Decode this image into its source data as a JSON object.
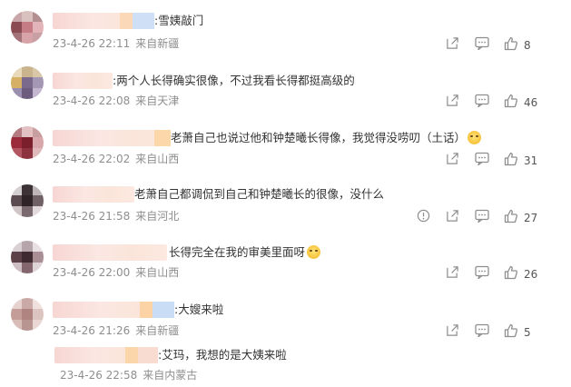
{
  "comments": [
    {
      "text": ":雪姨敲门",
      "time": "23-4-26 22:11",
      "location": "来自新疆",
      "likes": "8",
      "emoji": false
    },
    {
      "text": ":两个人长得确实很像，不过我看长得都挺高级的",
      "time": "23-4-26 22:08",
      "location": "来自天津",
      "likes": "46",
      "emoji": false
    },
    {
      "text": "老萧自己也说过他和钟楚曦长得像，我觉得没唠叨（土话）",
      "time": "23-4-26 22:02",
      "location": "来自山西",
      "likes": "31",
      "emoji": true
    },
    {
      "text": "老萧自己都调侃到自己和钟楚曦长的很像，没什么",
      "time": "23-4-26 21:58",
      "location": "来自河北",
      "likes": "27",
      "emoji": false
    },
    {
      "text": "长得完全在我的审美里面呀",
      "time": "23-4-26 22:00",
      "location": "来自山西",
      "likes": "26",
      "emoji": true
    },
    {
      "text": ":大嫂来啦",
      "time": "23-4-26 21:26",
      "location": "来自新疆",
      "likes": "5",
      "emoji": false
    }
  ],
  "reply": {
    "text": ":艾玛，我想的是大姨来啦",
    "time": "23-4-26 22:58",
    "location": "来自内蒙古"
  },
  "icons": {
    "share": "share-icon",
    "comment": "comment-icon",
    "like": "thumbs-up-icon",
    "report": "report-icon"
  }
}
